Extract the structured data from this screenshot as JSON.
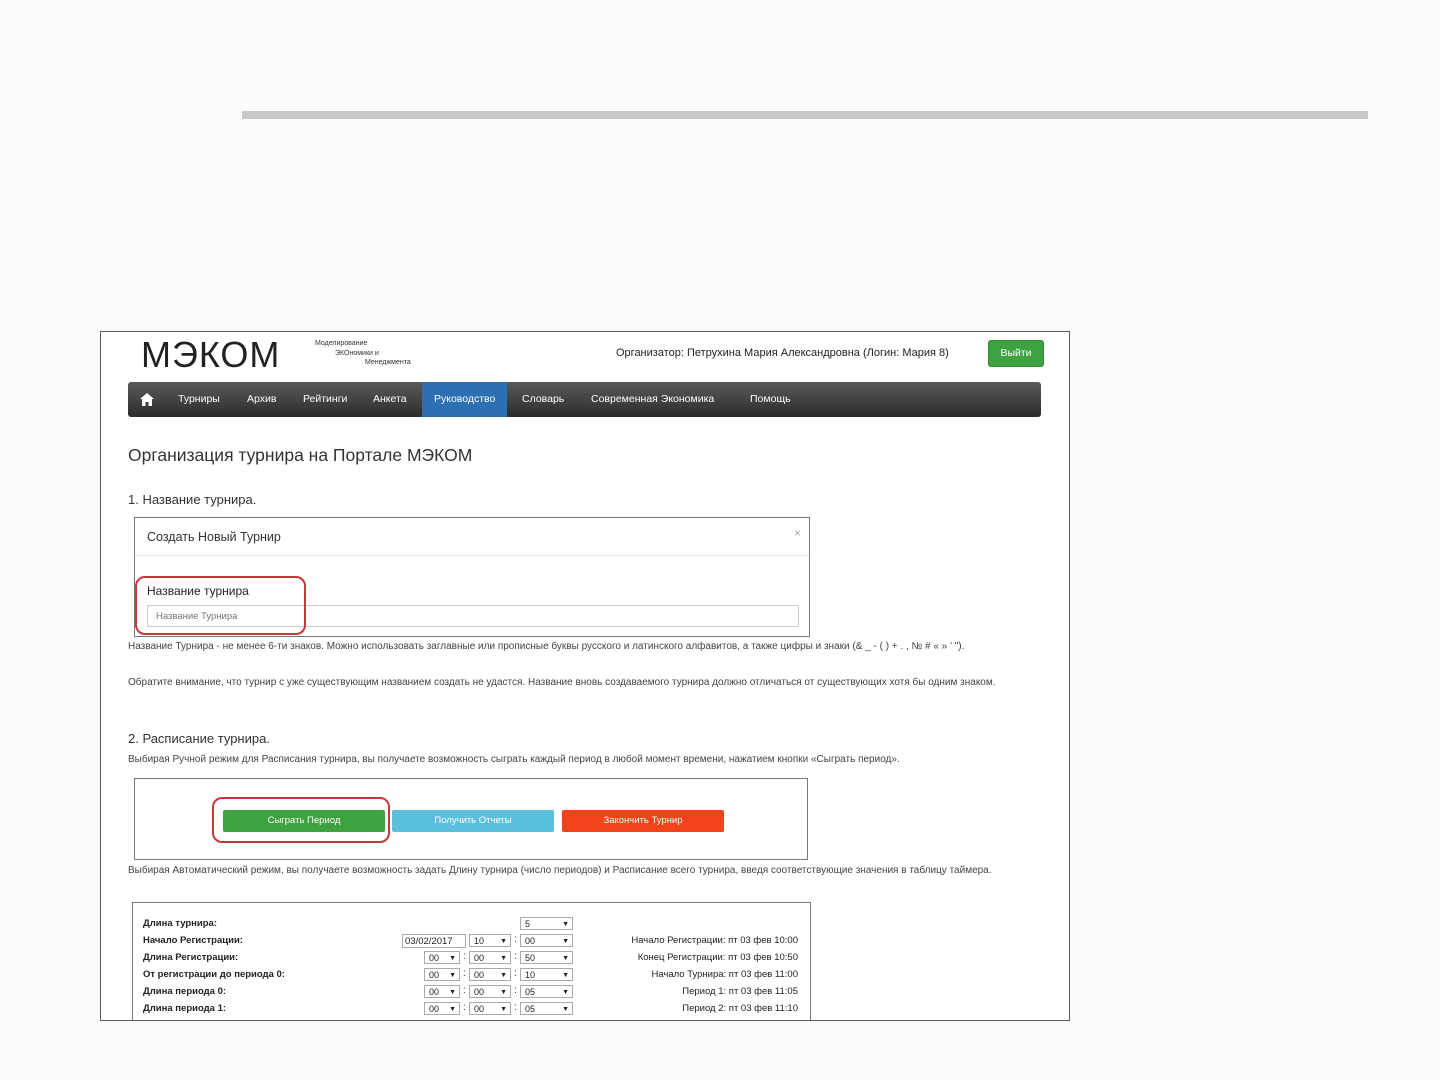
{
  "header": {
    "logo": "МЭКОМ",
    "logo_sub": [
      "Моделирование",
      "ЭКОномики и",
      "Менеджмента"
    ],
    "organizer": "Организатор: Петрухина Мария Александровна (Логин: Мария 8)",
    "logout_label": "Выйти"
  },
  "nav": {
    "home_icon": "home-icon",
    "items": [
      "Турниры",
      "Архив",
      "Рейтинги",
      "Анкета",
      "Руководство",
      "Словарь",
      "Современная Экономика",
      "Помощь"
    ],
    "active": "Руководство"
  },
  "page_title": "Организация турнира на Портале МЭКОМ",
  "section1": {
    "heading": "1. Название турнира.",
    "modal_title": "Создать Новый Турнир",
    "close": "×",
    "field_label": "Название турнира",
    "field_placeholder": "Название Турнира",
    "para1": "Название Турнира - не менее 6-ти знаков. Можно использовать заглавные или прописные буквы русского и латинского алфавитов, а также цифры и знаки (& _ - ( ) + . , № # « » ' \").",
    "para2": "Обратите внимание, что турнир с уже существующим названием создать не удастся. Название вновь создаваемого турнира должно отличаться от существующих хотя бы одним знаком."
  },
  "section2": {
    "heading": "2. Расписание турнира.",
    "para1": "Выбирая Ручной режим для Расписания турнира, вы получаете возможность сыграть каждый период в любой момент времени, нажатием кнопки «Сыграть период».",
    "buttons": {
      "play": "Сыграть Период",
      "reports": "Получить Отчеты",
      "finish": "Закончить Турнир"
    },
    "para2": "Выбирая Автоматический режим, вы получаете возможность задать Длину турнира (число периодов) и Расписание всего турнира, введя соответствующие значения в таблицу таймера."
  },
  "timer": {
    "rows": [
      {
        "label": "Длина турнира:",
        "info": ""
      },
      {
        "label": "Начало Регистрации:",
        "date": "03/02/2017",
        "h": "10",
        "m": "00",
        "info": "Начало Регистрации: пт 03 фев 10:00"
      },
      {
        "label": "Длина Регистрации:",
        "d": "00",
        "h": "00",
        "m": "50",
        "info": "Конец Регистрации: пт 03 фев 10:50"
      },
      {
        "label": "От регистрации до периода 0:",
        "d": "00",
        "h": "00",
        "m": "10",
        "info": "Начало Турнира: пт 03 фев 11:00"
      },
      {
        "label": "Длина периода 0:",
        "d": "00",
        "h": "00",
        "m": "05",
        "info": "Период 1: пт 03 фев 11:05"
      },
      {
        "label": "Длина периода 1:",
        "d": "00",
        "h": "00",
        "m": "05",
        "info": "Период 2: пт 03 фев 11:10"
      }
    ],
    "length": "5"
  },
  "colors": {
    "green": "#3fa241",
    "blue": "#5bc0de",
    "red": "#f4421b",
    "nav_active": "#2c6fb3",
    "highlight": "#c9363a"
  }
}
